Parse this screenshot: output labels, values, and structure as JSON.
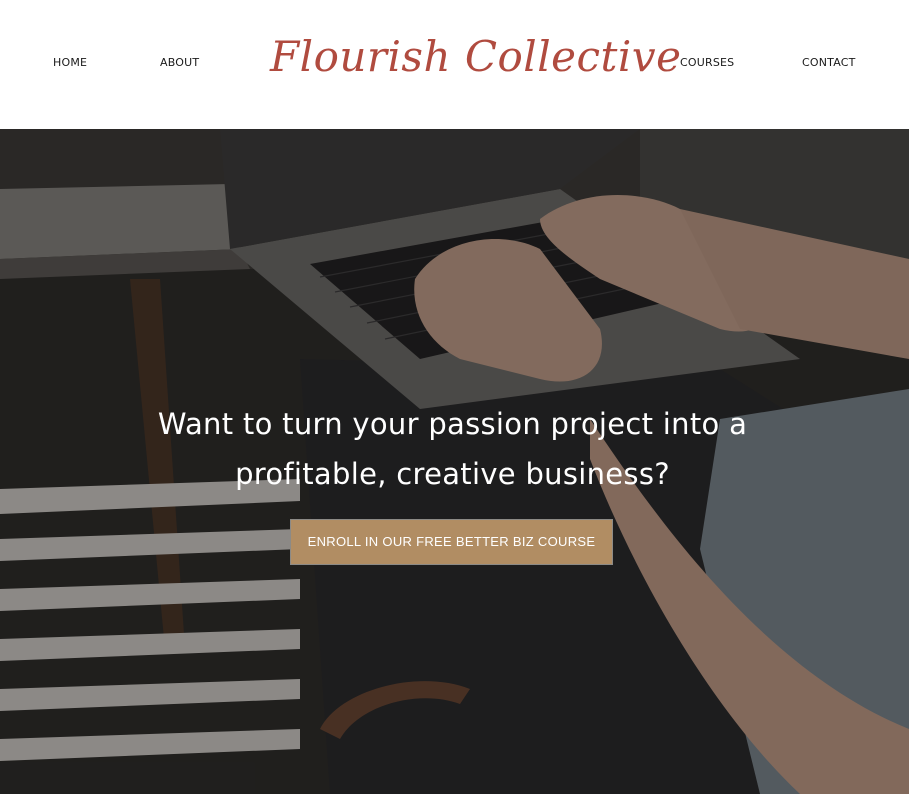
{
  "nav": {
    "home": "HOME",
    "about": "ABOUT",
    "courses": "COURSES",
    "contact": "CONTACT"
  },
  "logo": {
    "text": "Flourish Collective"
  },
  "hero": {
    "headline_line1": "Want to turn your passion project into a",
    "headline_line2": "profitable, creative business?",
    "cta_label": "ENROLL IN OUR FREE BETTER BIZ COURSE"
  },
  "colors": {
    "logo": "#b04b3f",
    "cta_background": "#b18d63",
    "header_background": "#ffffff",
    "headline_text": "#ffffff"
  }
}
